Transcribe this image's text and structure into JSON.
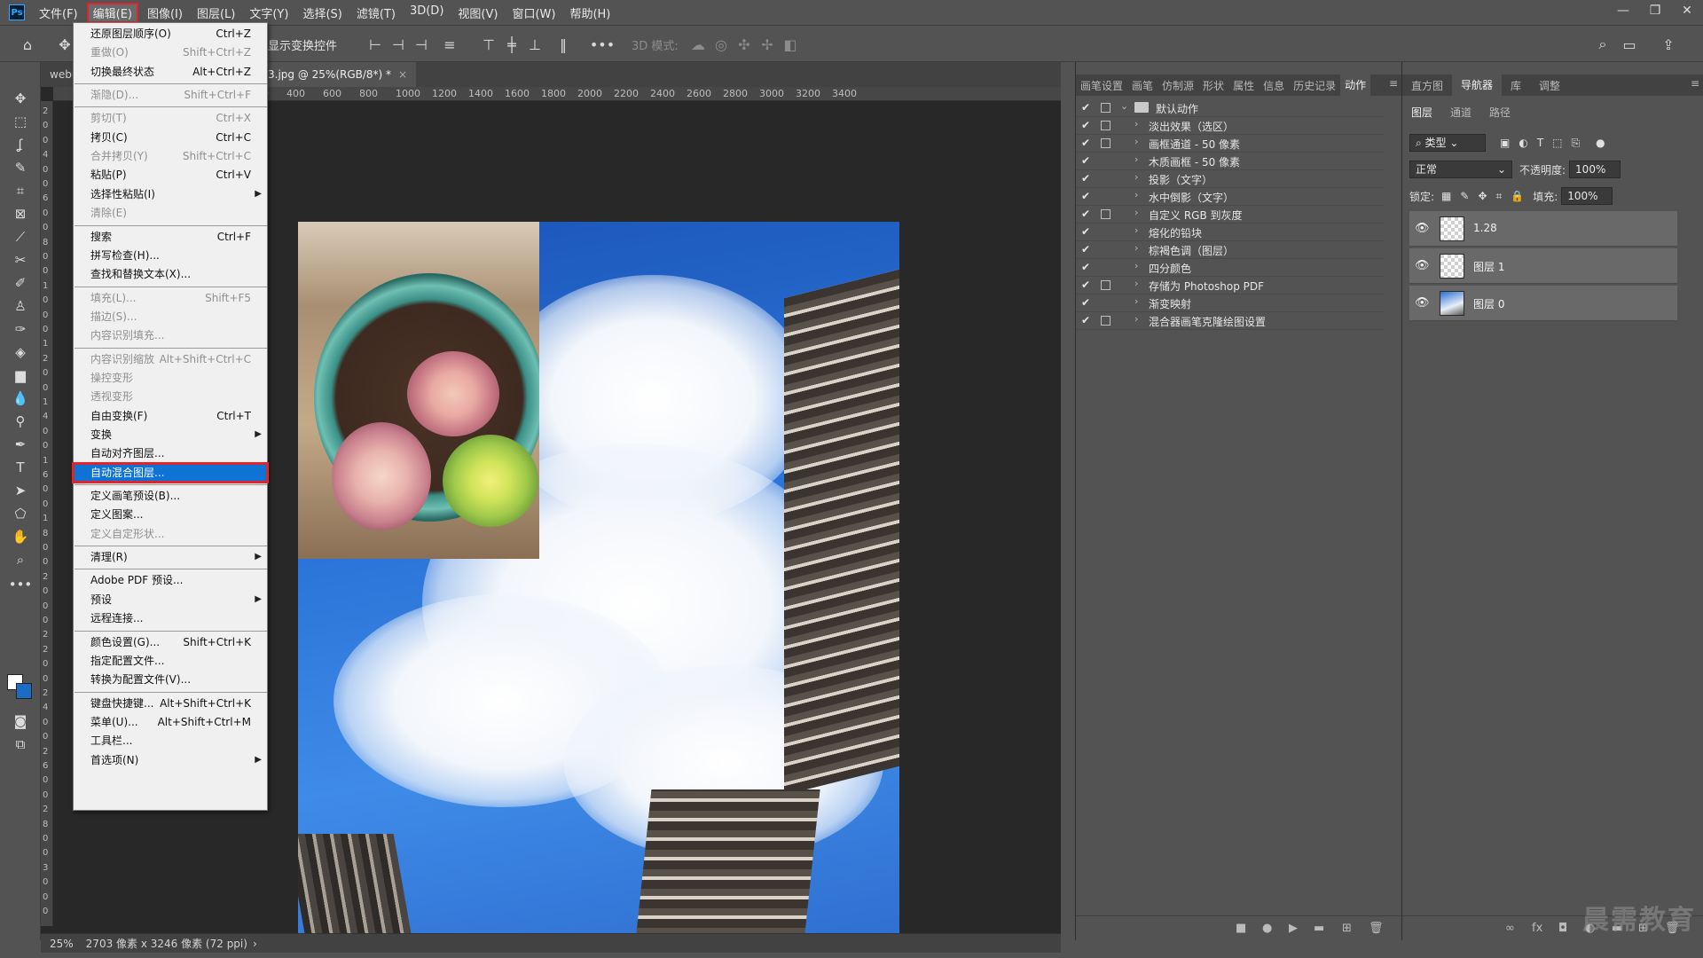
{
  "menubar": {
    "logo": "Ps",
    "items": [
      "文件(F)",
      "编辑(E)",
      "图像(I)",
      "图层(L)",
      "文字(Y)",
      "选择(S)",
      "滤镜(T)",
      "3D(D)",
      "视图(V)",
      "窗口(W)",
      "帮助(H)"
    ],
    "window_controls": [
      "—",
      "❐",
      "✕"
    ]
  },
  "optbar": {
    "label": "显示变换控件",
    "mode_3d": "3D 模式:"
  },
  "tabs": [
    {
      "label": "webu"
    },
    {
      "label": "3.jpg @ 25%(RGB/8*) *",
      "close": "×"
    }
  ],
  "ruler": {
    "h_labels": [
      "200",
      "400",
      "600",
      "800",
      "1000",
      "1200",
      "1400",
      "1600",
      "1800",
      "2000",
      "2200",
      "2400",
      "2600",
      "2800",
      "3000",
      "3200",
      "3400"
    ],
    "v_labels": [
      "2",
      "0",
      "0",
      "4",
      "0",
      "0",
      "6",
      "0",
      "0",
      "8",
      "0",
      "0",
      "1",
      "0",
      "0",
      "0",
      "1",
      "2",
      "0",
      "0",
      "1",
      "4",
      "0",
      "0",
      "1",
      "6",
      "0",
      "0",
      "1",
      "8",
      "0",
      "0",
      "2",
      "0",
      "0",
      "0",
      "2",
      "2",
      "0",
      "0",
      "2",
      "4",
      "0",
      "0",
      "2",
      "6",
      "0",
      "0",
      "2",
      "8",
      "0",
      "0",
      "3",
      "0",
      "0",
      "0"
    ]
  },
  "edit_menu": {
    "items": [
      {
        "label": "还原图层顺序(O)",
        "shortcut": "Ctrl+Z",
        "disabled": false
      },
      {
        "label": "重做(O)",
        "shortcut": "Shift+Ctrl+Z",
        "disabled": true
      },
      {
        "label": "切换最终状态",
        "shortcut": "Alt+Ctrl+Z",
        "disabled": false
      },
      {
        "sep": true
      },
      {
        "label": "渐隐(D)...",
        "shortcut": "Shift+Ctrl+F",
        "disabled": true
      },
      {
        "sep": true
      },
      {
        "label": "剪切(T)",
        "shortcut": "Ctrl+X",
        "disabled": true
      },
      {
        "label": "拷贝(C)",
        "shortcut": "Ctrl+C",
        "disabled": false
      },
      {
        "label": "合并拷贝(Y)",
        "shortcut": "Shift+Ctrl+C",
        "disabled": true
      },
      {
        "label": "粘贴(P)",
        "shortcut": "Ctrl+V",
        "disabled": false
      },
      {
        "label": "选择性粘贴(I)",
        "shortcut": "",
        "disabled": false,
        "submenu": true
      },
      {
        "label": "清除(E)",
        "shortcut": "",
        "disabled": true
      },
      {
        "sep": true
      },
      {
        "label": "搜索",
        "shortcut": "Ctrl+F",
        "disabled": false
      },
      {
        "label": "拼写检查(H)...",
        "shortcut": "",
        "disabled": false
      },
      {
        "label": "查找和替换文本(X)...",
        "shortcut": "",
        "disabled": false
      },
      {
        "sep": true
      },
      {
        "label": "填充(L)...",
        "shortcut": "Shift+F5",
        "disabled": true
      },
      {
        "label": "描边(S)...",
        "shortcut": "",
        "disabled": true
      },
      {
        "label": "内容识别填充...",
        "shortcut": "",
        "disabled": true
      },
      {
        "sep": true
      },
      {
        "label": "内容识别缩放",
        "shortcut": "Alt+Shift+Ctrl+C",
        "disabled": true
      },
      {
        "label": "操控变形",
        "shortcut": "",
        "disabled": true
      },
      {
        "label": "透视变形",
        "shortcut": "",
        "disabled": true
      },
      {
        "label": "自由变换(F)",
        "shortcut": "Ctrl+T",
        "disabled": false
      },
      {
        "label": "变换",
        "shortcut": "",
        "disabled": false,
        "submenu": true
      },
      {
        "label": "自动对齐图层...",
        "shortcut": "",
        "disabled": false
      },
      {
        "label": "自动混合图层...",
        "shortcut": "",
        "disabled": false,
        "selected": true
      },
      {
        "sep": true
      },
      {
        "label": "定义画笔预设(B)...",
        "shortcut": "",
        "disabled": false
      },
      {
        "label": "定义图案...",
        "shortcut": "",
        "disabled": false
      },
      {
        "label": "定义自定形状...",
        "shortcut": "",
        "disabled": true
      },
      {
        "sep": true
      },
      {
        "label": "清理(R)",
        "shortcut": "",
        "disabled": false,
        "submenu": true
      },
      {
        "sep": true
      },
      {
        "label": "Adobe PDF 预设...",
        "shortcut": "",
        "disabled": false
      },
      {
        "label": "预设",
        "shortcut": "",
        "disabled": false,
        "submenu": true
      },
      {
        "label": "远程连接...",
        "shortcut": "",
        "disabled": false
      },
      {
        "sep": true
      },
      {
        "label": "颜色设置(G)...",
        "shortcut": "Shift+Ctrl+K",
        "disabled": false
      },
      {
        "label": "指定配置文件...",
        "shortcut": "",
        "disabled": false
      },
      {
        "label": "转换为配置文件(V)...",
        "shortcut": "",
        "disabled": false
      },
      {
        "sep": true
      },
      {
        "label": "键盘快捷键...",
        "shortcut": "Alt+Shift+Ctrl+K",
        "disabled": false
      },
      {
        "label": "菜单(U)...",
        "shortcut": "Alt+Shift+Ctrl+M",
        "disabled": false
      },
      {
        "label": "工具栏...",
        "shortcut": "",
        "disabled": false
      },
      {
        "label": "首选项(N)",
        "shortcut": "",
        "disabled": false,
        "submenu": true
      }
    ]
  },
  "actions_panel": {
    "tabs": [
      "画笔设置",
      "画笔",
      "仿制源",
      "形状",
      "属性",
      "信息",
      "历史记录",
      "动作"
    ],
    "active_tab": "动作",
    "set_name": "默认动作",
    "actions": [
      {
        "label": "淡出效果（选区）",
        "dialog": true
      },
      {
        "label": "画框通道 - 50 像素",
        "dialog": true
      },
      {
        "label": "木质画框 - 50 像素",
        "dialog": false
      },
      {
        "label": "投影（文字）",
        "dialog": false
      },
      {
        "label": "水中倒影（文字）",
        "dialog": false
      },
      {
        "label": "自定义 RGB 到灰度",
        "dialog": true
      },
      {
        "label": "熔化的铅块",
        "dialog": false
      },
      {
        "label": "棕褐色调（图层）",
        "dialog": false
      },
      {
        "label": "四分颜色",
        "dialog": false
      },
      {
        "label": "存储为 Photoshop PDF",
        "dialog": true
      },
      {
        "label": "渐变映射",
        "dialog": false
      },
      {
        "label": "混合器画笔克隆绘图设置",
        "dialog": true
      }
    ]
  },
  "layers_panel": {
    "top_tabs": [
      "直方图",
      "导航器",
      "库",
      "调整"
    ],
    "active_top_tab": "导航器",
    "tabs": [
      "图层",
      "通道",
      "路径"
    ],
    "active_tab": "图层",
    "filter_label": "类型",
    "blend_mode": "正常",
    "opacity_label": "不透明度:",
    "opacity_value": "100%",
    "lock_label": "锁定:",
    "fill_label": "填充:",
    "fill_value": "100%",
    "layers": [
      {
        "name": "1.28",
        "thumb": "checker"
      },
      {
        "name": "图层 1",
        "thumb": "checker"
      },
      {
        "name": "图层 0",
        "thumb": "photo"
      }
    ]
  },
  "statusbar": {
    "zoom": "25%",
    "info": "2703 像素 x 3246 像素 (72 ppi)"
  },
  "watermark": "晨需教育"
}
